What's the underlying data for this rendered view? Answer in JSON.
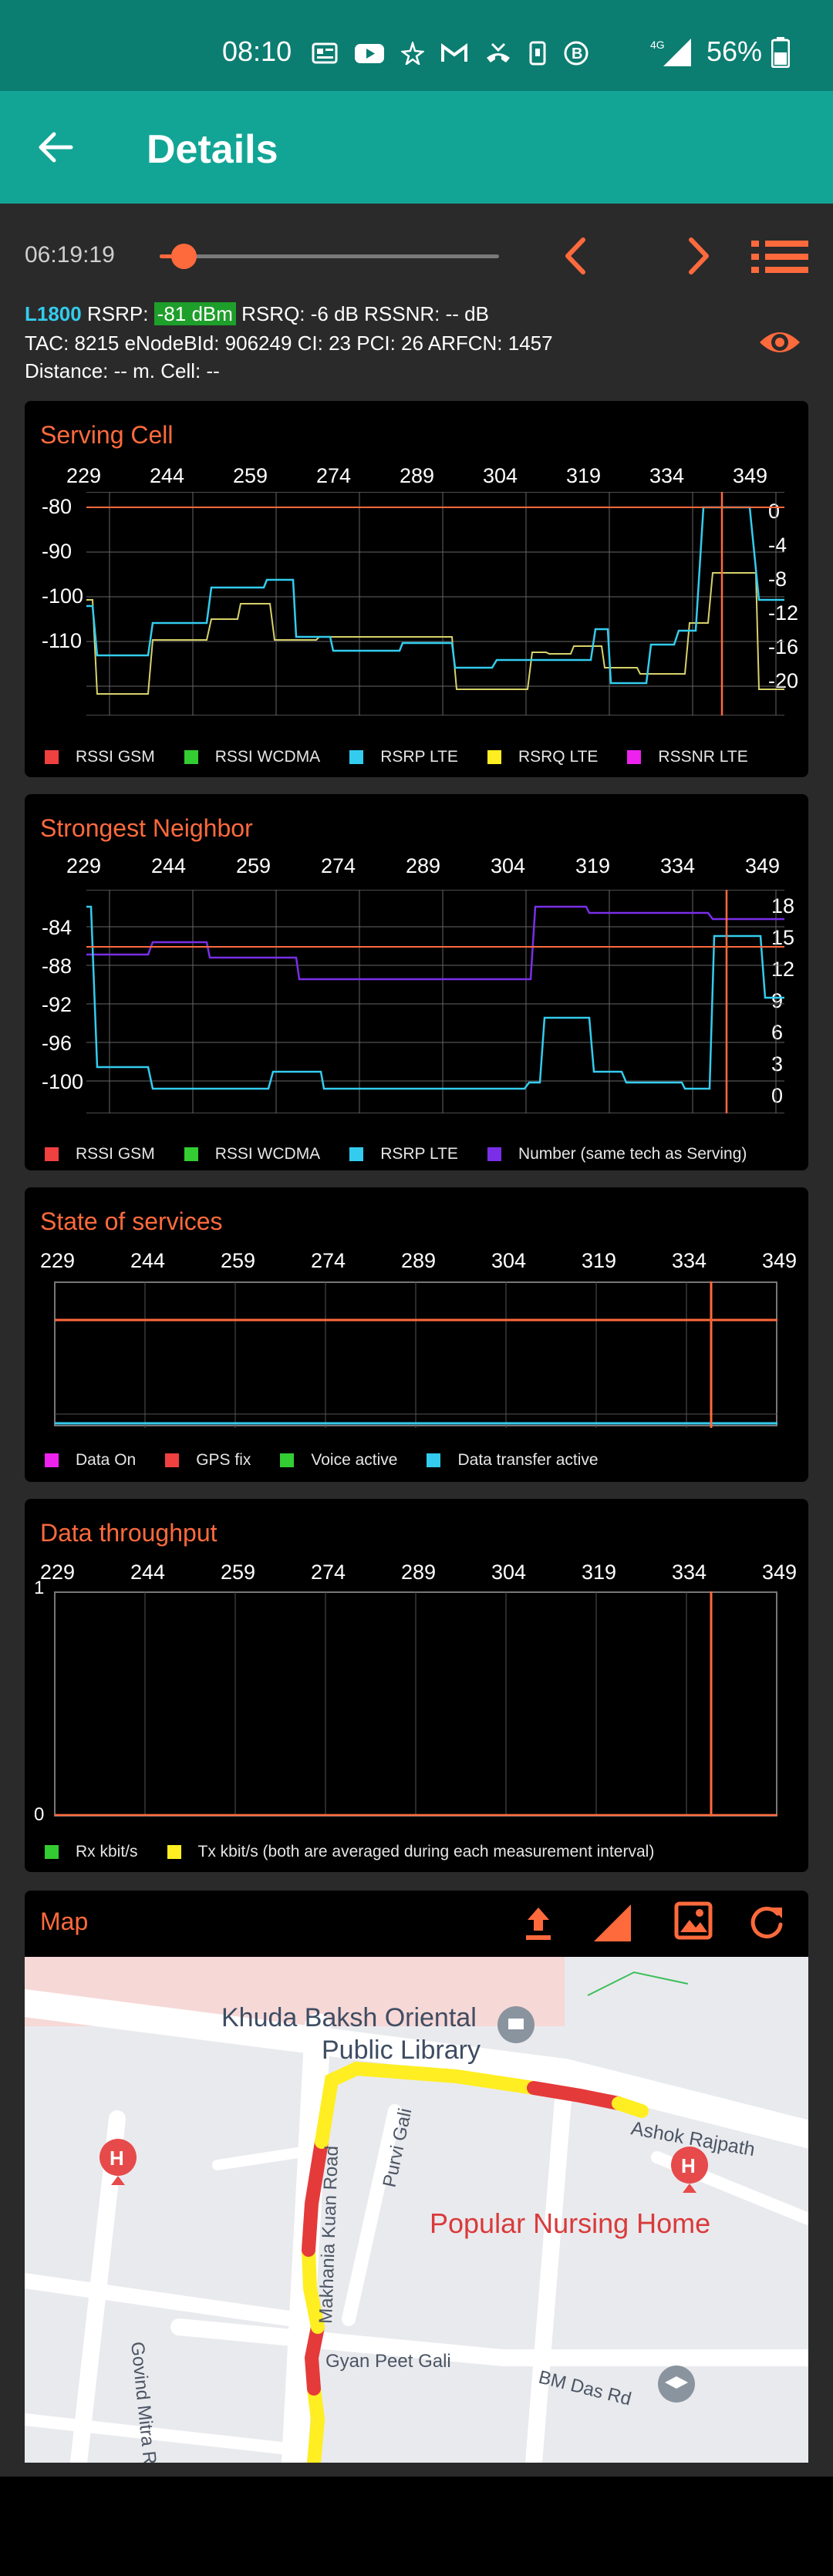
{
  "status": {
    "time": "08:10",
    "network": "4G",
    "battery": "56%"
  },
  "appbar": {
    "title": "Details"
  },
  "controls": {
    "time": "06:19:19",
    "slider_fraction": 0.07
  },
  "info": {
    "line1": {
      "band": "L1800",
      "rsrp_label": "RSRP:",
      "rsrp_value": "-81 dBm",
      "rest": "RSRQ: -6 dB  RSSNR: -- dB"
    },
    "line2": "TAC: 8215  eNodeBId: 906249  CI: 23  PCI: 26  ARFCN: 1457",
    "line3": "Distance: -- m.   Cell: --"
  },
  "colors": {
    "accent": "#ff6a3d",
    "teal": "#12a596",
    "rsrp_highlight": "#1e9e2a"
  },
  "x_ticks": [
    "229",
    "244",
    "259",
    "274",
    "289",
    "304",
    "319",
    "334",
    "349"
  ],
  "serving": {
    "title": "Serving Cell",
    "y_left": [
      "-80",
      "-90",
      "-100",
      "-110"
    ],
    "y_right": [
      "0",
      "-4",
      "-8",
      "-12",
      "-16",
      "-20"
    ],
    "legend": [
      {
        "label": "RSSI GSM",
        "color": "#f04040"
      },
      {
        "label": "RSSI WCDMA",
        "color": "#33cc33"
      },
      {
        "label": "RSRP LTE",
        "color": "#33ccee"
      },
      {
        "label": "RSRQ LTE",
        "color": "#ffee22"
      },
      {
        "label": "RSSNR LTE",
        "color": "#ee22ee"
      }
    ]
  },
  "neighbor": {
    "title": "Strongest Neighbor",
    "y_left": [
      "-84",
      "-88",
      "-92",
      "-96",
      "-100"
    ],
    "y_right": [
      "18",
      "15",
      "12",
      "9",
      "6",
      "3",
      "0"
    ],
    "legend": [
      {
        "label": "RSSI GSM",
        "color": "#f04040"
      },
      {
        "label": "RSSI WCDMA",
        "color": "#33cc33"
      },
      {
        "label": "RSRP LTE",
        "color": "#33ccee"
      },
      {
        "label": "Number (same tech as Serving)",
        "color": "#7a2ee8"
      }
    ]
  },
  "services": {
    "title": "State of services",
    "legend": [
      {
        "label": "Data On",
        "color": "#ee22ee"
      },
      {
        "label": "GPS fix",
        "color": "#f04040"
      },
      {
        "label": "Voice active",
        "color": "#33cc33"
      },
      {
        "label": "Data transfer active",
        "color": "#33ccee"
      }
    ]
  },
  "throughput": {
    "title": "Data throughput",
    "y_labels": [
      "1",
      "0"
    ],
    "legend": [
      {
        "label": "Rx kbit/s",
        "color": "#33cc33"
      },
      {
        "label": "Tx kbit/s (both are averaged during each measurement interval)",
        "color": "#ffee22"
      }
    ]
  },
  "map": {
    "title": "Map",
    "labels": {
      "library": "Khuda Baksh Oriental",
      "library2": "Public Library",
      "ashok": "Ashok Rajpath",
      "nursing": "Popular Nursing Home",
      "makhania": "Makhania Kuan Road",
      "purvi": "Purvi Gali",
      "govind": "Govind Mitra Rd",
      "gyan": "Gyan Peet Gali",
      "bmdas": "BM Das Rd"
    }
  }
}
